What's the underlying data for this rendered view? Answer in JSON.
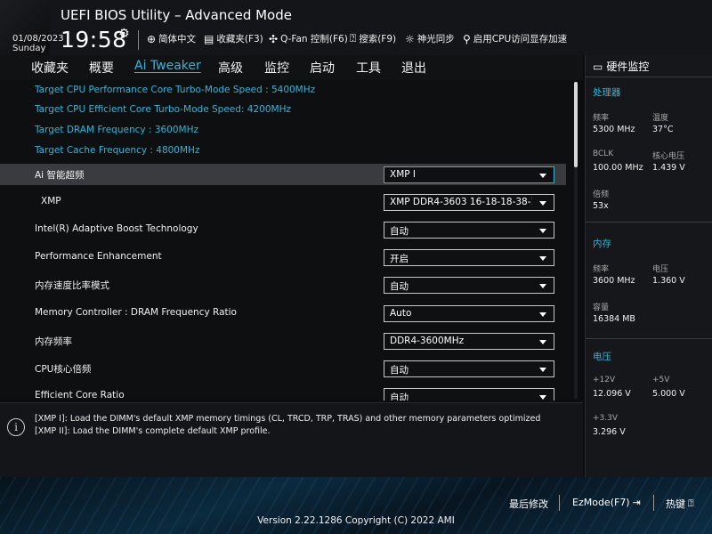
{
  "header": {
    "title": "UEFI BIOS Utility – Advanced Mode",
    "date": "01/08/2023",
    "day": "Sunday",
    "time": "19:58",
    "tools": [
      {
        "icon": "globe-icon",
        "label": "简体中文"
      },
      {
        "icon": "bookmark-icon",
        "label": "收藏夹(F3)"
      },
      {
        "icon": "fan-icon",
        "label": "Q-Fan 控制(F6)"
      },
      {
        "icon": "help-icon",
        "label": "搜索(F9)"
      },
      {
        "icon": "aura-icon",
        "label": "神光同步"
      },
      {
        "icon": "cpu-access-icon",
        "label": "启用CPU访问显存加速"
      }
    ]
  },
  "nav": {
    "tabs": [
      "收藏夹",
      "概要",
      "Ai Tweaker",
      "高级",
      "监控",
      "启动",
      "工具",
      "退出"
    ],
    "active": "Ai Tweaker"
  },
  "main": {
    "targets": [
      "Target CPU Performance Core Turbo-Mode Speed : 5400MHz",
      "Target CPU Efficient Core Turbo-Mode Speed: 4200MHz",
      "Target DRAM Frequency : 3600MHz",
      "Target Cache Frequency : 4800MHz"
    ],
    "settings": [
      {
        "label": "Ai 智能超频",
        "value": "XMP I"
      },
      {
        "label": "XMP",
        "value": "XMP DDR4-3603 16-18-18-38-1.35V"
      },
      {
        "label": "Intel(R) Adaptive Boost Technology",
        "value": "自动"
      },
      {
        "label": "Performance Enhancement",
        "value": "开启"
      },
      {
        "label": "内存速度比率模式",
        "value": "自动"
      },
      {
        "label": "Memory Controller : DRAM Frequency Ratio",
        "value": "Auto"
      },
      {
        "label": "内存频率",
        "value": "DDR4-3600MHz"
      },
      {
        "label": "CPU核心倍频",
        "value": "自动"
      },
      {
        "label": "Efficient Core Ratio",
        "value": "自动"
      }
    ]
  },
  "help": {
    "lines": [
      "[XMP I]:  Load the DIMM's default XMP memory timings (CL, TRCD, TRP, TRAS) and other memory parameters optimized",
      "[XMP II]:  Load the DIMM's complete default XMP profile."
    ]
  },
  "monitor": {
    "title": "硬件监控",
    "cpu": {
      "section": "处理器",
      "freq_label": "频率",
      "freq": "5300 MHz",
      "temp_label": "温度",
      "temp": "37°C",
      "bclk_label": "BCLK",
      "bclk": "100.00 MHz",
      "vcore_label": "核心电压",
      "vcore": "1.439 V",
      "ratio_label": "倍频",
      "ratio": "53x"
    },
    "memory": {
      "section": "内存",
      "freq_label": "频率",
      "freq": "3600 MHz",
      "volt_label": "电压",
      "volt": "1.360 V",
      "cap_label": "容量",
      "cap": "16384 MB"
    },
    "voltage": {
      "section": "电压",
      "v12_label": "+12V",
      "v12": "12.096 V",
      "v5_label": "+5V",
      "v5": "5.000 V",
      "v33_label": "+3.3V",
      "v33": "3.296 V"
    }
  },
  "footer": {
    "last_modified": "最后修改",
    "ezmode": "EzMode(F7)",
    "hotkeys": "热键",
    "version": "Version 2.22.1286 Copyright (C) 2022 AMI"
  },
  "colors": {
    "accent": "#2fb7d9",
    "highlight_row": "#3a3b3e"
  }
}
